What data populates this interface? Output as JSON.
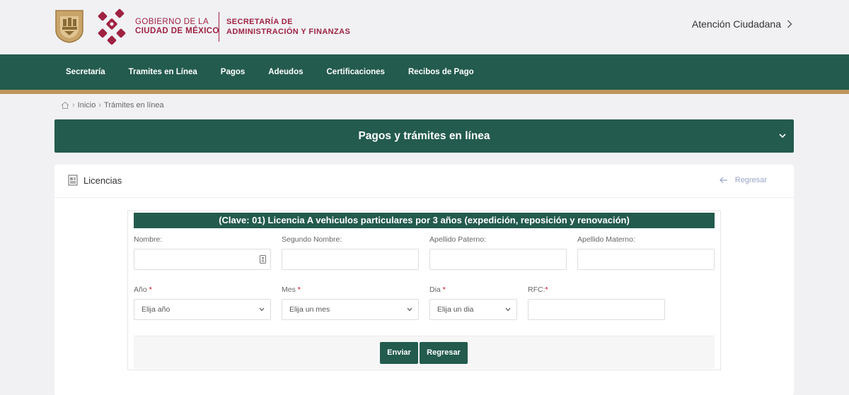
{
  "header": {
    "gob_line1": "GOBIERNO DE LA",
    "gob_line2": "CIUDAD DE MÉXICO",
    "sec_line1": "SECRETARÍA DE",
    "sec_line2": "ADMINISTRACIÓN Y FINANZAS",
    "atencion": "Atención Ciudadana"
  },
  "colors": {
    "primary_green": "#235b4e",
    "gold": "#bc955c",
    "brand_red": "#9f2241"
  },
  "nav": {
    "items": [
      "Secretaría",
      "Tramites en Línea",
      "Pagos",
      "Adeudos",
      "Certificaciones",
      "Recibos de Pago"
    ]
  },
  "breadcrumb": {
    "home_icon": "home-icon",
    "items": [
      "Inicio",
      "Trámites en línea"
    ],
    "separator": "›"
  },
  "banner": {
    "title": "Pagos y trámites en línea"
  },
  "card": {
    "title": "Licencias",
    "back_label": "Regresar"
  },
  "form": {
    "title": "(Clave: 01) Licencia A vehiculos particulares por 3 años (expedición, reposición y renovación)",
    "labels": {
      "nombre": "Nombre:",
      "segundo_nombre": "Segundo Nombre:",
      "apellido_paterno": "Apellido Paterno:",
      "apellido_materno": "Apellido Materno:",
      "anio": "Año",
      "mes": "Mes",
      "dia": "Dia",
      "rfc": "RFC:",
      "required": "*"
    },
    "values": {
      "nombre": "",
      "segundo_nombre": "",
      "apellido_paterno": "",
      "apellido_materno": "",
      "rfc": ""
    },
    "selects": {
      "anio": "Elija año",
      "mes": "Elija un mes",
      "dia": "Elija un dia"
    },
    "buttons": {
      "enviar": "Enviar",
      "regresar": "Regresar"
    }
  }
}
